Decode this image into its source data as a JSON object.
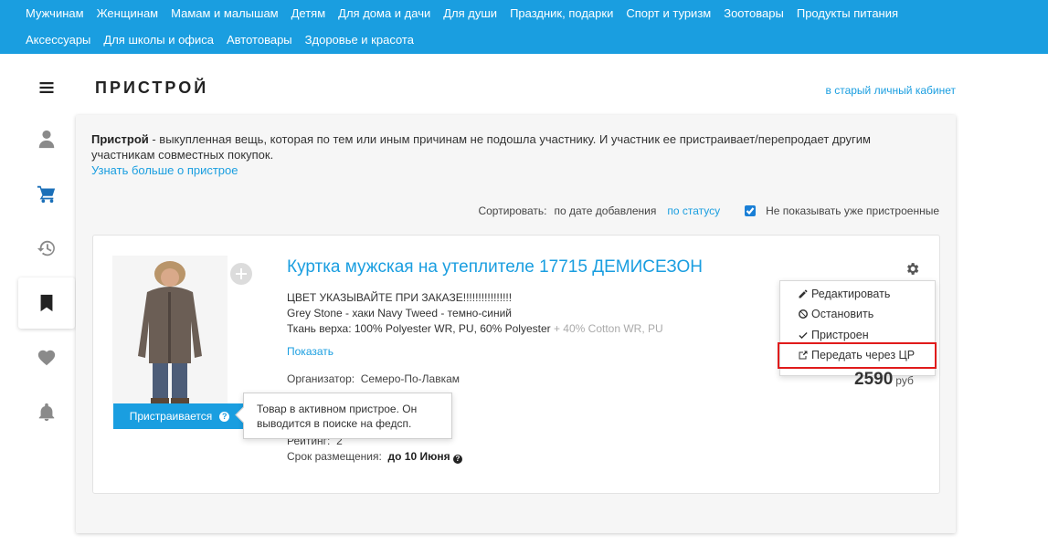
{
  "nav": {
    "row1": [
      "Мужчинам",
      "Женщинам",
      "Мамам и малышам",
      "Детям",
      "Для дома и дачи",
      "Для души",
      "Праздник, подарки",
      "Спорт и туризм",
      "Зоотовары",
      "Продукты питания"
    ],
    "row2": [
      "Аксессуары",
      "Для школы и офиса",
      "Автотовары",
      "Здоровье и красота"
    ]
  },
  "sidebar": {
    "items": [
      {
        "icon": "menu-icon"
      },
      {
        "icon": "user-icon"
      },
      {
        "icon": "cart-icon"
      },
      {
        "icon": "history-icon"
      },
      {
        "icon": "bookmark-icon",
        "active": true
      },
      {
        "icon": "heart-icon"
      },
      {
        "icon": "bell-icon"
      }
    ]
  },
  "header": {
    "title": "ПРИСТРОЙ",
    "old_cabinet_link": "в старый личный кабинет"
  },
  "intro": {
    "term": "Пристрой",
    "text": " - выкупленная вещь, которая по тем или иным причинам не подошла участнику. И участник ее пристраивает/перепродает другим участникам совместных покупок.",
    "learn_more": "Узнать больше о пристрое"
  },
  "sort": {
    "label": "Сортировать:",
    "option_date": "по дате добавления",
    "option_status": "по статусу",
    "hide_checkbox_label": "Не показывать уже пристроенные",
    "hide_checked": true
  },
  "item": {
    "title": "Куртка мужская на утеплителе 17715 ДЕМИСЕЗОН",
    "desc_line1": "ЦВЕТ УКАЗЫВАЙТЕ ПРИ ЗАКАЗЕ!!!!!!!!!!!!!!!!",
    "desc_line2": "Grey Stone - хаки Navy Tweed - темно-синий",
    "desc_line3_main": "Ткань верха: 100% Polyester WR, PU, 60% Polyester",
    "desc_line3_fade": " + 40% Cotton WR, PU",
    "show_link": "Показать",
    "organizer_label": "Организатор:",
    "organizer_value": "Семеро-По-Лавкам",
    "rating_label": "Рейтинг:",
    "rating_value": "2",
    "term_label": "Срок размещения:",
    "term_value": "до 10 Июня",
    "status_button": "Пристраивается",
    "tooltip": "Товар в активном пристрое. Он выводится в поиске на федсп.",
    "price": "2590",
    "currency": "руб"
  },
  "menu": {
    "edit": "Редактировать",
    "stop": "Остановить",
    "placed": "Пристроен",
    "transfer": "Передать через ЦР"
  },
  "colors": {
    "accent": "#1a9ee0",
    "highlight": "#e01b1b"
  }
}
